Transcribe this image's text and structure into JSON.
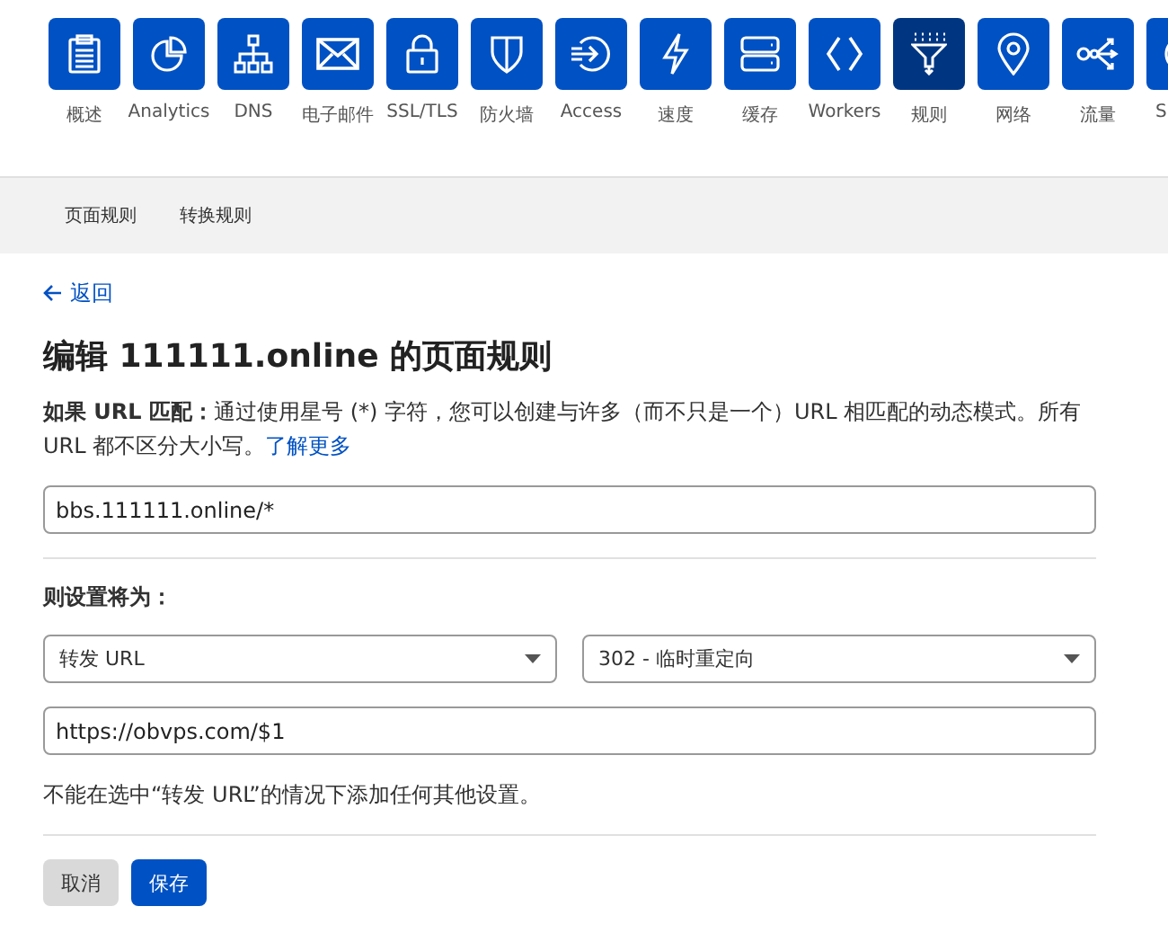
{
  "nav": [
    {
      "kind": "overview",
      "label": "概述",
      "selected": false
    },
    {
      "kind": "analytics",
      "label": "Analytics",
      "selected": false
    },
    {
      "kind": "dns",
      "label": "DNS",
      "selected": false
    },
    {
      "kind": "email",
      "label": "电子邮件",
      "selected": false
    },
    {
      "kind": "ssl",
      "label": "SSL/TLS",
      "selected": false
    },
    {
      "kind": "firewall",
      "label": "防火墙",
      "selected": false
    },
    {
      "kind": "access",
      "label": "Access",
      "selected": false
    },
    {
      "kind": "speed",
      "label": "速度",
      "selected": false
    },
    {
      "kind": "cache",
      "label": "缓存",
      "selected": false
    },
    {
      "kind": "workers",
      "label": "Workers",
      "selected": false
    },
    {
      "kind": "rules",
      "label": "规则",
      "selected": true
    },
    {
      "kind": "network",
      "label": "网络",
      "selected": false
    },
    {
      "kind": "traffic",
      "label": "流量",
      "selected": false
    },
    {
      "kind": "cut",
      "label": "S",
      "selected": false
    }
  ],
  "tabs": [
    "页面规则",
    "转换规则"
  ],
  "back_link": "返回",
  "title": "编辑 111111.online 的页面规则",
  "match": {
    "label": "如果 URL 匹配：",
    "text": "通过使用星号 (*) 字符，您可以创建与许多（而不只是一个）URL 相匹配的动态模式。所有 URL 都不区分大小写。",
    "link": "了解更多",
    "value": "bbs.111111.online/*"
  },
  "settings": {
    "label": "则设置将为：",
    "setting": "转发 URL",
    "status_code": "302 - 临时重定向",
    "destination": "https://obvps.com/$1",
    "note": "不能在选中“转发 URL”的情况下添加任何其他设置。"
  },
  "buttons": {
    "cancel": "取消",
    "save": "保存"
  }
}
